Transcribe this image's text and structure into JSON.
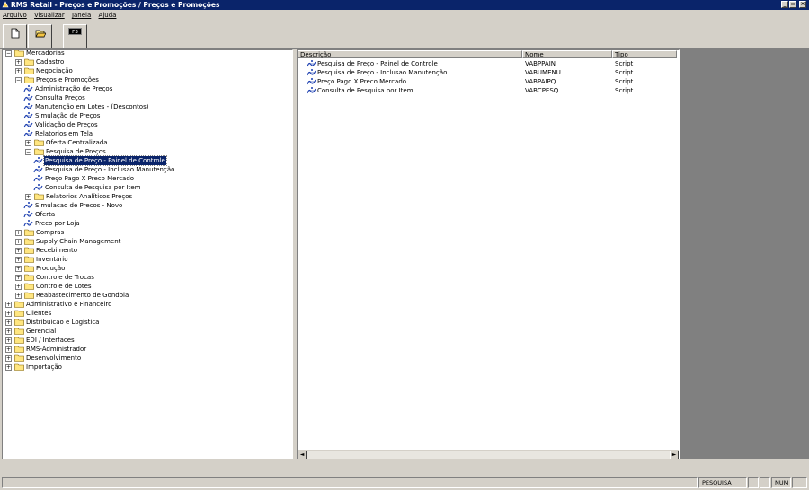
{
  "window": {
    "title": "RMS Retail - Preços e Promoções / Preços e Promoções",
    "buttons": [
      "_",
      "▫",
      "×"
    ]
  },
  "menu": [
    "Arquivo",
    "Visualizar",
    "Janela",
    "Ajuda"
  ],
  "toolbar": {
    "f3_label": "F3"
  },
  "tree": [
    {
      "label": "Mercadorias",
      "expander": "−",
      "level": 0,
      "type": "folder"
    },
    {
      "label": "Cadastro",
      "expander": "+",
      "level": 1,
      "type": "folder"
    },
    {
      "label": "Negociação",
      "expander": "+",
      "level": 1,
      "type": "folder"
    },
    {
      "label": "Preços e Promoções",
      "expander": "−",
      "level": 1,
      "type": "folder"
    },
    {
      "label": "Administração de Preços",
      "level": 2,
      "type": "script"
    },
    {
      "label": "Consulta Preços",
      "level": 2,
      "type": "script"
    },
    {
      "label": "Manutenção em Lotes - (Descontos)",
      "level": 2,
      "type": "script"
    },
    {
      "label": "Simulação de Preços",
      "level": 2,
      "type": "script"
    },
    {
      "label": "Validação de Preços",
      "level": 2,
      "type": "script"
    },
    {
      "label": "Relatorios em Tela",
      "level": 2,
      "type": "script"
    },
    {
      "label": "Oferta Centralizada",
      "expander": "+",
      "level": 2,
      "type": "folder"
    },
    {
      "label": "Pesquisa de Preços",
      "expander": "−",
      "level": 2,
      "type": "folder"
    },
    {
      "label": "Pesquisa de Preço - Painel de Controle",
      "level": 3,
      "type": "script",
      "selected": true
    },
    {
      "label": "Pesquisa de Preço - Inclusao Manutenção",
      "level": 3,
      "type": "script"
    },
    {
      "label": "Preço Pago X Preco Mercado",
      "level": 3,
      "type": "script"
    },
    {
      "label": "Consulta de Pesquisa por Item",
      "level": 3,
      "type": "script"
    },
    {
      "label": "Relatorios Analíticos Preços",
      "expander": "+",
      "level": 2,
      "type": "folder"
    },
    {
      "label": "Simulacao de Precos - Novo",
      "level": 2,
      "type": "script"
    },
    {
      "label": "Oferta",
      "level": 2,
      "type": "script"
    },
    {
      "label": "Preco por Loja",
      "level": 2,
      "type": "script"
    },
    {
      "label": "Compras",
      "expander": "+",
      "level": 1,
      "type": "folder"
    },
    {
      "label": "Supply Chain Management",
      "expander": "+",
      "level": 1,
      "type": "folder"
    },
    {
      "label": "Recebimento",
      "expander": "+",
      "level": 1,
      "type": "folder"
    },
    {
      "label": "Inventário",
      "expander": "+",
      "level": 1,
      "type": "folder"
    },
    {
      "label": "Produção",
      "expander": "+",
      "level": 1,
      "type": "folder"
    },
    {
      "label": "Controle de Trocas",
      "expander": "+",
      "level": 1,
      "type": "folder"
    },
    {
      "label": "Controle de Lotes",
      "expander": "+",
      "level": 1,
      "type": "folder"
    },
    {
      "label": "Reabastecimento de Gondola",
      "expander": "+",
      "level": 1,
      "type": "folder"
    },
    {
      "label": "Administrativo e Financeiro",
      "expander": "+",
      "level": 0,
      "type": "folder"
    },
    {
      "label": "Clientes",
      "expander": "+",
      "level": 0,
      "type": "folder"
    },
    {
      "label": "Distribuicao e Logistica",
      "expander": "+",
      "level": 0,
      "type": "folder"
    },
    {
      "label": "Gerencial",
      "expander": "+",
      "level": 0,
      "type": "folder"
    },
    {
      "label": "EDI / Interfaces",
      "expander": "+",
      "level": 0,
      "type": "folder"
    },
    {
      "label": "RMS-Administrador",
      "expander": "+",
      "level": 0,
      "type": "folder"
    },
    {
      "label": "Desenvolvimento",
      "expander": "+",
      "level": 0,
      "type": "folder"
    },
    {
      "label": "Importação",
      "expander": "+",
      "level": 0,
      "type": "folder"
    }
  ],
  "list": {
    "headers": {
      "descricao": "Descrição",
      "nome": "Nome",
      "tipo": "Tipo"
    },
    "rows": [
      {
        "descricao": "Pesquisa de Preço - Painel de Controle",
        "nome": "VABPPAIN",
        "tipo": "Script"
      },
      {
        "descricao": "Pesquisa de Preço - Inclusao Manutenção",
        "nome": "VABUMENU",
        "tipo": "Script"
      },
      {
        "descricao": "Preço Pago X Preco Mercado",
        "nome": "VABPAIPQ",
        "tipo": "Script"
      },
      {
        "descricao": "Consulta de Pesquisa por Item",
        "nome": "VABCPESQ",
        "tipo": "Script"
      }
    ]
  },
  "scroll": {
    "left": "◄",
    "right": "►"
  },
  "status": {
    "mode": "PESQUISA",
    "num": "NUM"
  },
  "colors": {
    "titlebar": "#0a246a",
    "face": "#d4d0c8",
    "mdi": "#808080",
    "folder": "#ffe680",
    "selection": "#0a246a"
  }
}
